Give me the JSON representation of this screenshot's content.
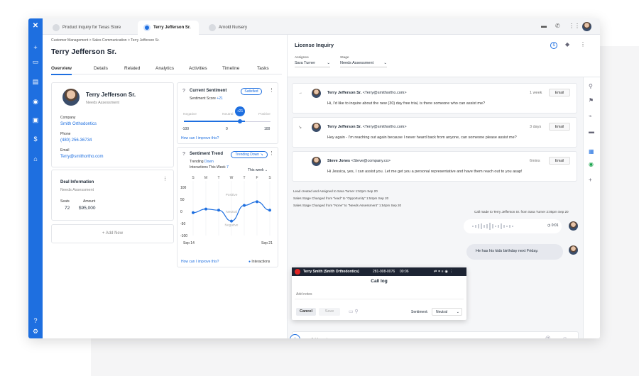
{
  "tabs": [
    {
      "label": "Product Inquiry for Texas Store"
    },
    {
      "label": "Terry Jefferson Sr."
    },
    {
      "label": "Arnold Nursery"
    }
  ],
  "breadcrumb": "Customer Management  >  Sales Communication  >  Terry Jefferson Sr.",
  "contact": {
    "name": "Terry Jefferson Sr.",
    "status": "Needs Assessment",
    "company_label": "Company",
    "company": "Smith Orthodontics",
    "phone_label": "Phone",
    "phone": "(480) 256-36734",
    "email_label": "Email",
    "email": "Terry@smithortho.com"
  },
  "nav": [
    "Overview",
    "Details",
    "Related",
    "Analytics",
    "Activities",
    "Timeline",
    "Tasks"
  ],
  "deal": {
    "title": "Deal Information",
    "status": "Needs Assessment",
    "seats_label": "Seats",
    "seats": "72",
    "amount_label": "Amount",
    "amount": "$95,000",
    "add_new": "+ Add New"
  },
  "sentiment": {
    "title": "Current Sentiment",
    "badge": "Satisfied",
    "score_label": "Sentiment Score",
    "score": "+21",
    "bubble": "+21",
    "neg": "Negative",
    "neu": "Neutral",
    "pos": "Positive",
    "min": "-100",
    "mid": "0",
    "max": "100",
    "link": "How can I improve this?",
    "value": 21
  },
  "trend": {
    "title": "Sentiment Trend",
    "badge": "Trending Down",
    "trending": "Trending",
    "trending_dir": "Down",
    "interactions": "Interactions This Week",
    "interactions_count": "7",
    "period": "This week",
    "days": [
      "S",
      "M",
      "T",
      "W",
      "T",
      "F",
      "S"
    ],
    "y_labels": [
      "100",
      "50",
      "0",
      "-50",
      "-100"
    ],
    "pos": "Positive",
    "neu": "Neutral",
    "neg": "Negative",
    "start": "Sep 14",
    "end": "Sep 21",
    "link": "How can I improve this?",
    "legend": "Interactions"
  },
  "chart_data": {
    "type": "line",
    "x": [
      "S",
      "M",
      "T",
      "W",
      "T",
      "F",
      "S"
    ],
    "series": [
      {
        "name": "Interactions",
        "values": [
          -5,
          10,
          5,
          -40,
          25,
          40,
          5
        ]
      }
    ],
    "ylim": [
      -100,
      100
    ]
  },
  "license": {
    "title": "License Inquiry",
    "assignee_label": "Assignee",
    "assignee": "Sara Turner",
    "stage_label": "Stage",
    "stage": "Needs Assessment"
  },
  "messages": [
    {
      "from": "Terry Jefferson Sr.",
      "email": "<Terry@smithortho.com>",
      "time": "1 week",
      "text": "Hi, I'd like to inquire about the new (30) day free trial, is there someone who can assist me?",
      "btn": "Email"
    },
    {
      "from": "Terry Jefferson Sr.",
      "email": "<Terry@smithortho.com>",
      "time": "3 days",
      "text": "Hey again - I'm reaching out again because I never heard back from anyone, can someone please assist me?",
      "btn": "Email"
    },
    {
      "from": "Steve Jones",
      "email": "<Steve@company.co>",
      "time": "6mins",
      "text": "Hi Jessica, yes, I can assist you.  Let me get you a personal representative and have them reach out to you asap!",
      "btn": "Email"
    }
  ],
  "logs": [
    "Lead created and Assigned to Sara Turner 1:52pm Sep 20",
    "Sales Stage Changed from \"lead\" to \"Opportunity\" 1:54pm Sep 20",
    "Sales Stage Changed from \"None\" to \"Needs Assessment\" 1:54pm Sep 20"
  ],
  "call_made": "Call made to Terry Jefferson Sr. from Sara Turner 2:05pm Sep 20",
  "call_time": "0:01",
  "bubble_note": "He has his kids birthday next Friday.",
  "call": {
    "caller": "Terry Smith (Smith Orthodontics)",
    "number": "281-908-0076",
    "duration": "00:06",
    "title": "Call log",
    "placeholder": "Add notes",
    "cancel": "Cancel",
    "save": "Save",
    "sentiment_label": "Sentiment:",
    "sentiment": "Neutral"
  },
  "note_placeholder": "Add a note..."
}
